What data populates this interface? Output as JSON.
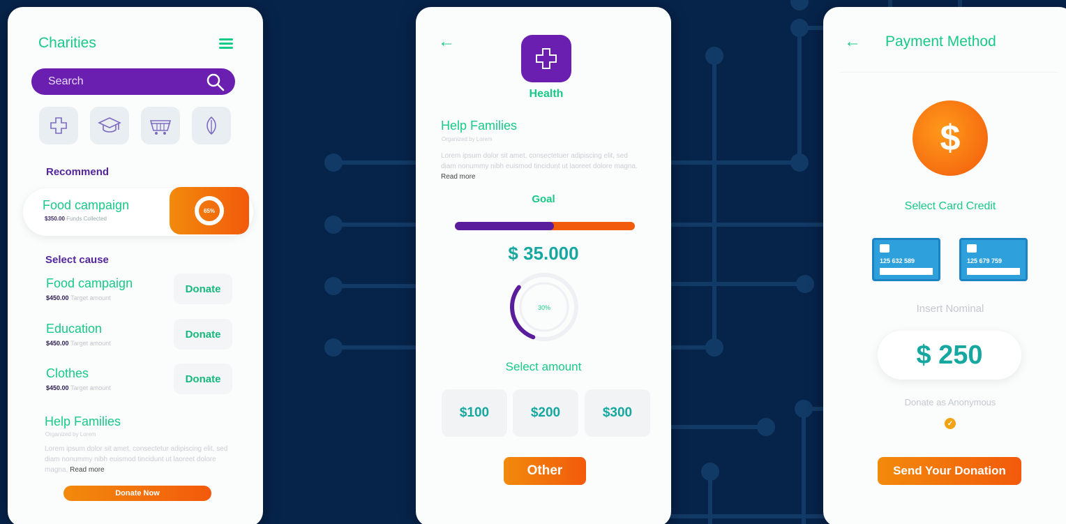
{
  "charities": {
    "title": "Charities",
    "search_placeholder": "Search",
    "categories": [
      "health-cross-icon",
      "graduation-cap-icon",
      "basket-icon",
      "leaf-icon"
    ],
    "recommend_label": "Recommend",
    "recommend": {
      "name": "Food campaign",
      "amount": "$350.00",
      "amount_note": "Funds Collected",
      "percent_label": "65%"
    },
    "select_cause_label": "Select cause",
    "causes": [
      {
        "name": "Food campaign",
        "amount": "$450.00",
        "note": "Target amount",
        "button": "Donate"
      },
      {
        "name": "Education",
        "amount": "$450.00",
        "note": "Target amount",
        "button": "Donate"
      },
      {
        "name": "Clothes",
        "amount": "$450.00",
        "note": "Target amount",
        "button": "Donate"
      }
    ],
    "help": {
      "title": "Help Families",
      "organizer": "Organized by Lorem",
      "description": "Lorem ipsum dolor sit amet, consectetur adipiscing elit, sed diam nonummy nibh euismod tincidunt ut laoreet dolore magna.",
      "read_more": "Read more"
    },
    "donate_now": "Donate Now"
  },
  "detail": {
    "back_icon": "arrow-left-icon",
    "category_label": "Health",
    "title": "Help Families",
    "organizer": "Organized by Lorem",
    "description": "Lorem ipsum dolor sit amet, consectetuer adipiscing elit, sed diam nonummy nibh euismod tincidunt ut laoreet dolore magna.",
    "read_more": "Read more",
    "goal_label": "Goal",
    "goal_progress": 0.55,
    "goal_amount": "$ 35.000",
    "percent": 30,
    "percent_label": "30%",
    "select_amount_label": "Select amount",
    "amounts": [
      "$100",
      "$200",
      "$300"
    ],
    "other_label": "Other"
  },
  "payment": {
    "title": "Payment Method",
    "select_card_label": "Select Card Credit",
    "cards": [
      "125 632 589",
      "125 679 759"
    ],
    "insert_nominal_label": "Insert Nominal",
    "nominal": "$ 250",
    "anonymous_label": "Donate as Anonymous",
    "anonymous_checked": true,
    "send_label": "Send Your Donation"
  },
  "colors": {
    "background": "#06234a",
    "green": "#18c987",
    "purple": "#5a1d9c",
    "orange": "#f25a0c",
    "teal": "#16a8a0"
  }
}
